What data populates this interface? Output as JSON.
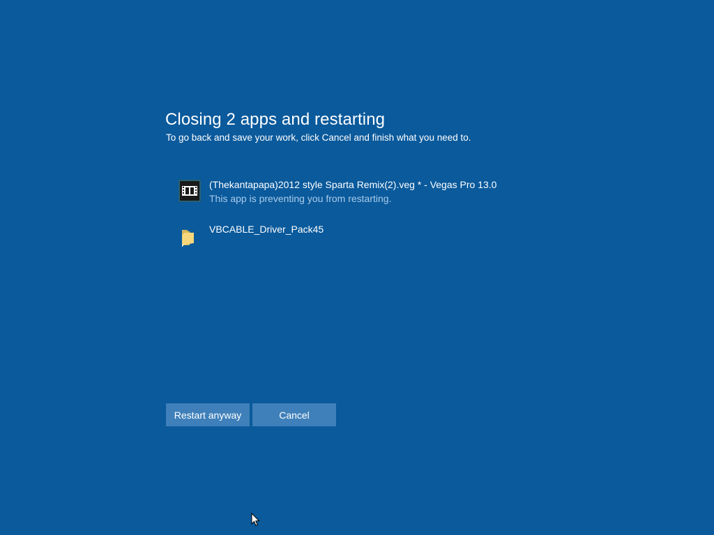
{
  "dialog": {
    "title": "Closing 2 apps and restarting",
    "subtitle": "To go back and save your work, click Cancel and finish what you need to."
  },
  "apps": [
    {
      "name": "(Thekantapapa)2012 style Sparta Remix(2).veg * - Vegas Pro 13.0",
      "status": "This app is preventing you from restarting.",
      "icon": "vegas-pro-film-icon"
    },
    {
      "name": "VBCABLE_Driver_Pack45",
      "status": "",
      "icon": "folder-icon"
    }
  ],
  "buttons": {
    "restart_label": "Restart anyway",
    "cancel_label": "Cancel"
  },
  "colors": {
    "background": "#0a5a9c",
    "button": "#3f80ba",
    "status_text": "#a9cbea"
  }
}
